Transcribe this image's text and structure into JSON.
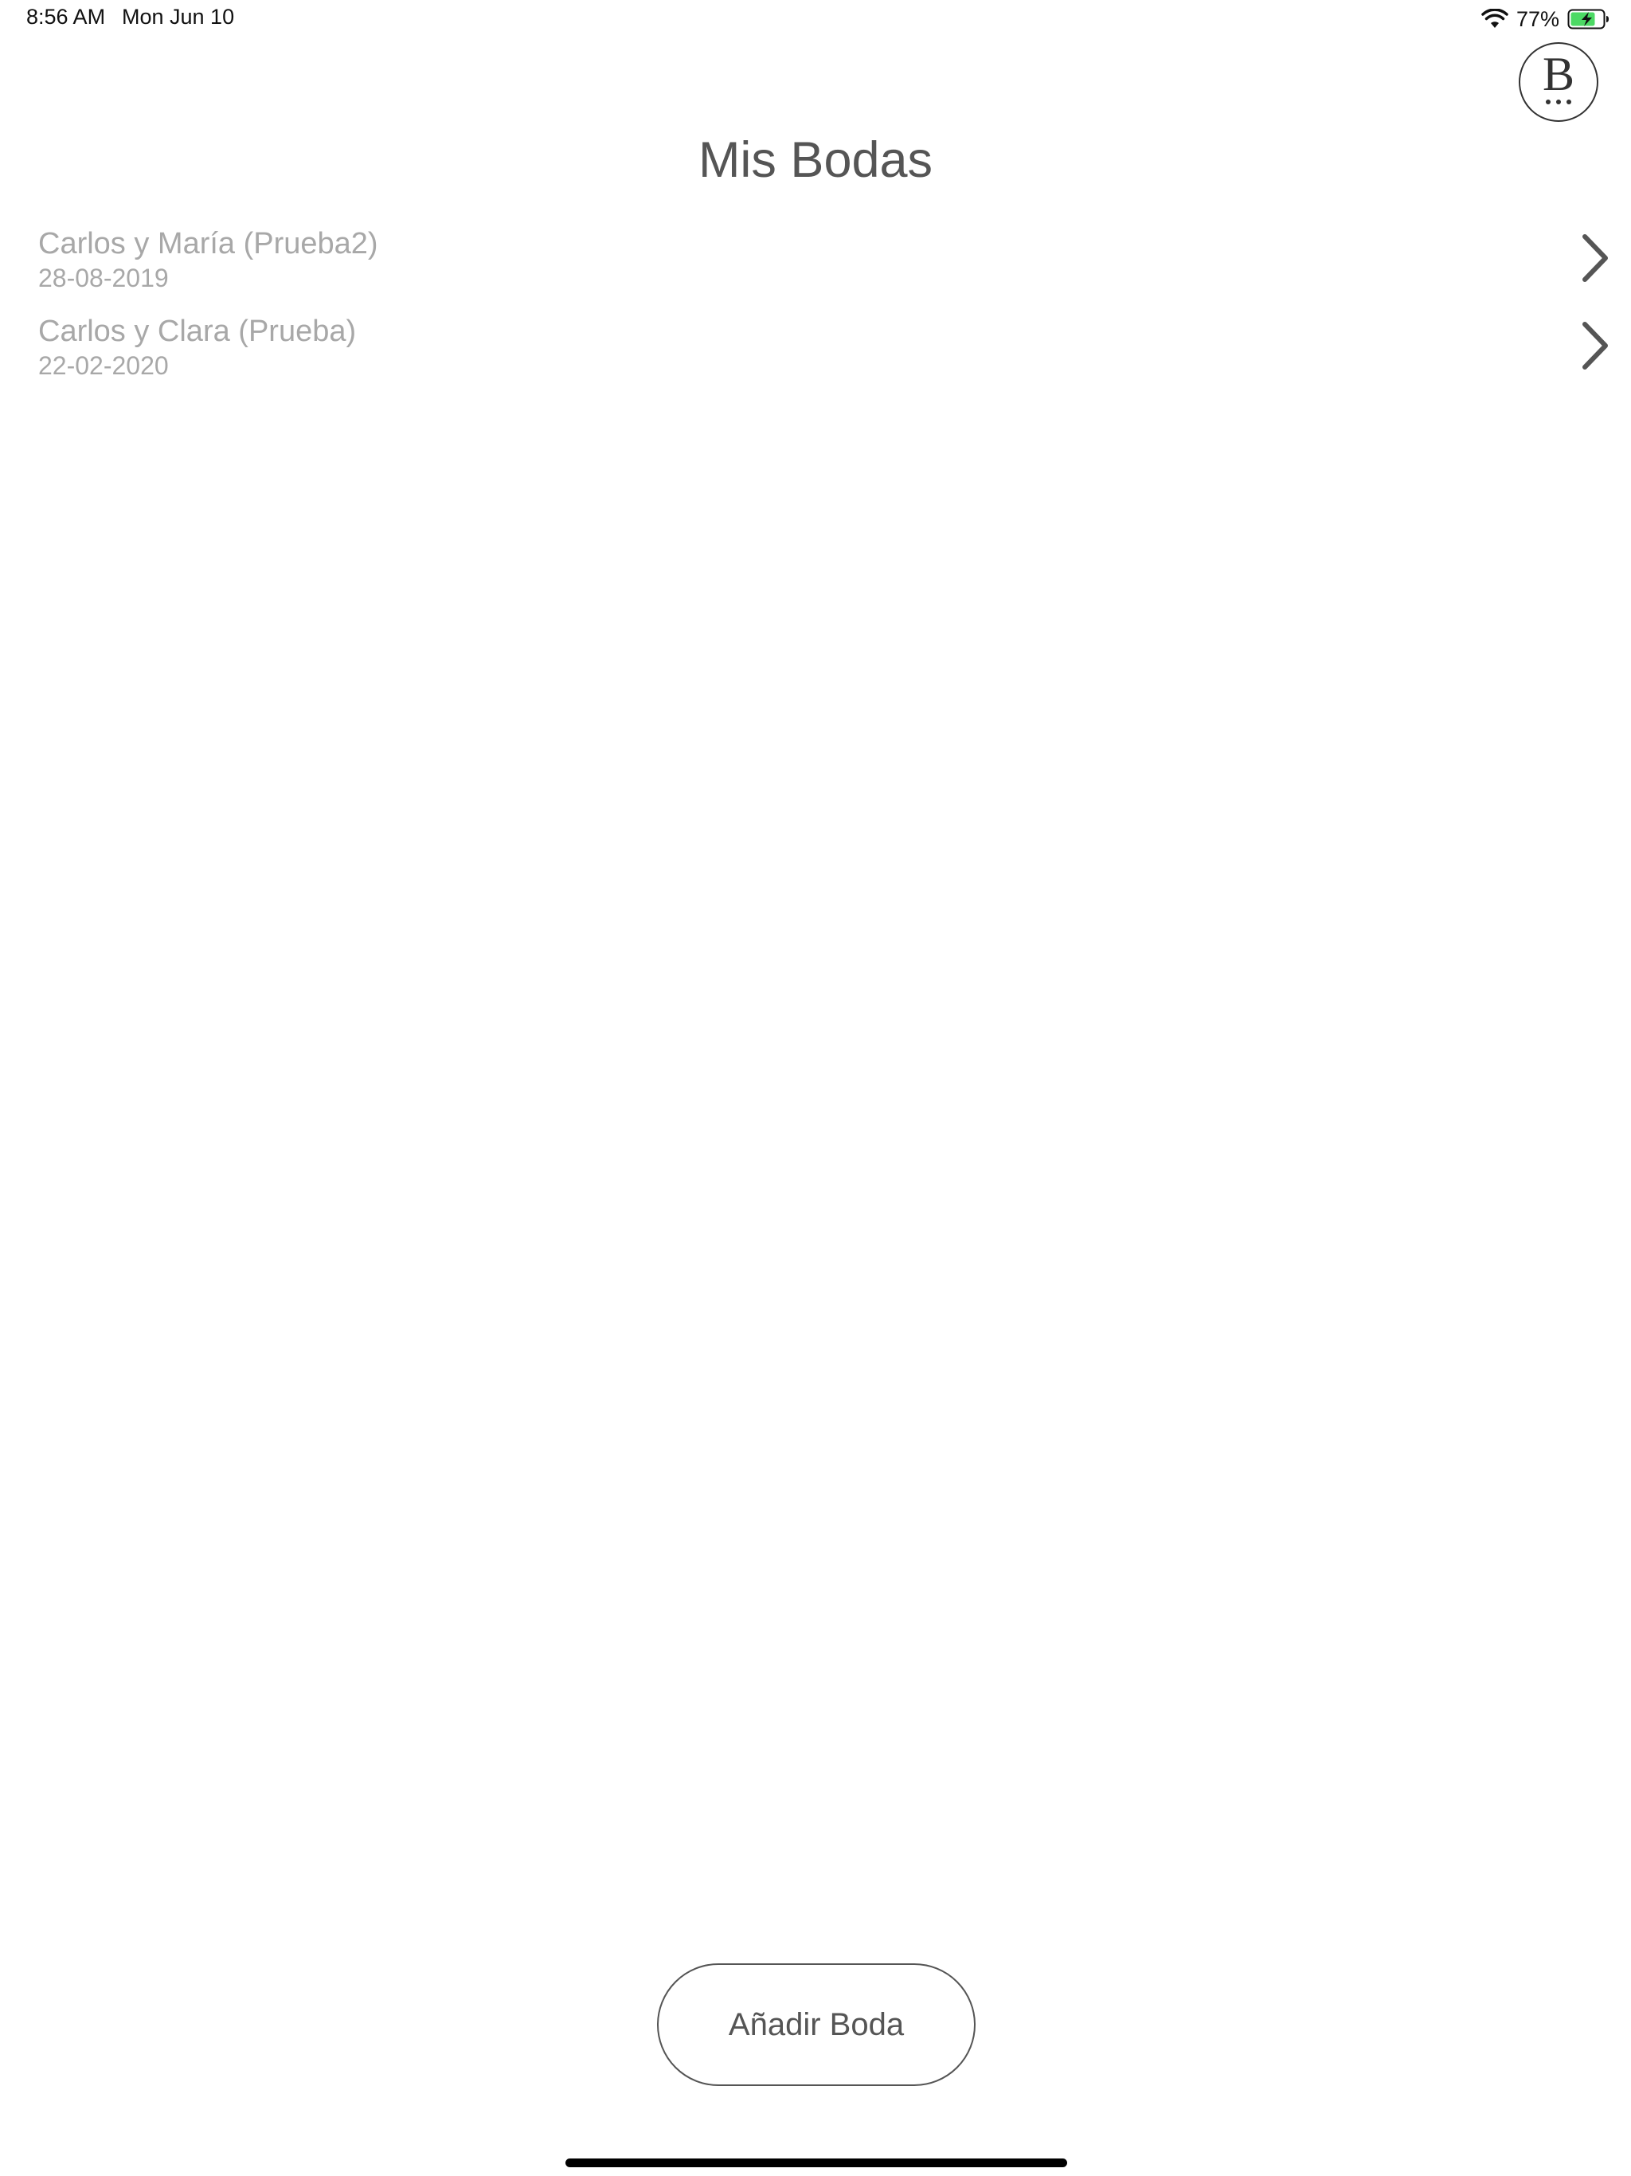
{
  "status_bar": {
    "time": "8:56 AM",
    "date": "Mon Jun 10",
    "battery_percent": "77%",
    "wifi_icon": "wifi-icon",
    "battery_icon": "battery-charging-icon",
    "battery_level": 0.77,
    "battery_color": "#4cd964"
  },
  "logo": {
    "letter": "B",
    "icon": "brand-logo"
  },
  "page": {
    "title": "Mis Bodas"
  },
  "weddings": [
    {
      "name": "Carlos y María (Prueba2)",
      "date": "28-08-2019",
      "icon": "chevron-right-icon"
    },
    {
      "name": "Carlos y Clara (Prueba)",
      "date": "22-02-2020",
      "icon": "chevron-right-icon"
    }
  ],
  "actions": {
    "add_wedding_label": "Añadir Boda"
  },
  "colors": {
    "title": "#555555",
    "list_text": "#a8a8a8",
    "chevron": "#555555",
    "button_border": "#555555"
  }
}
